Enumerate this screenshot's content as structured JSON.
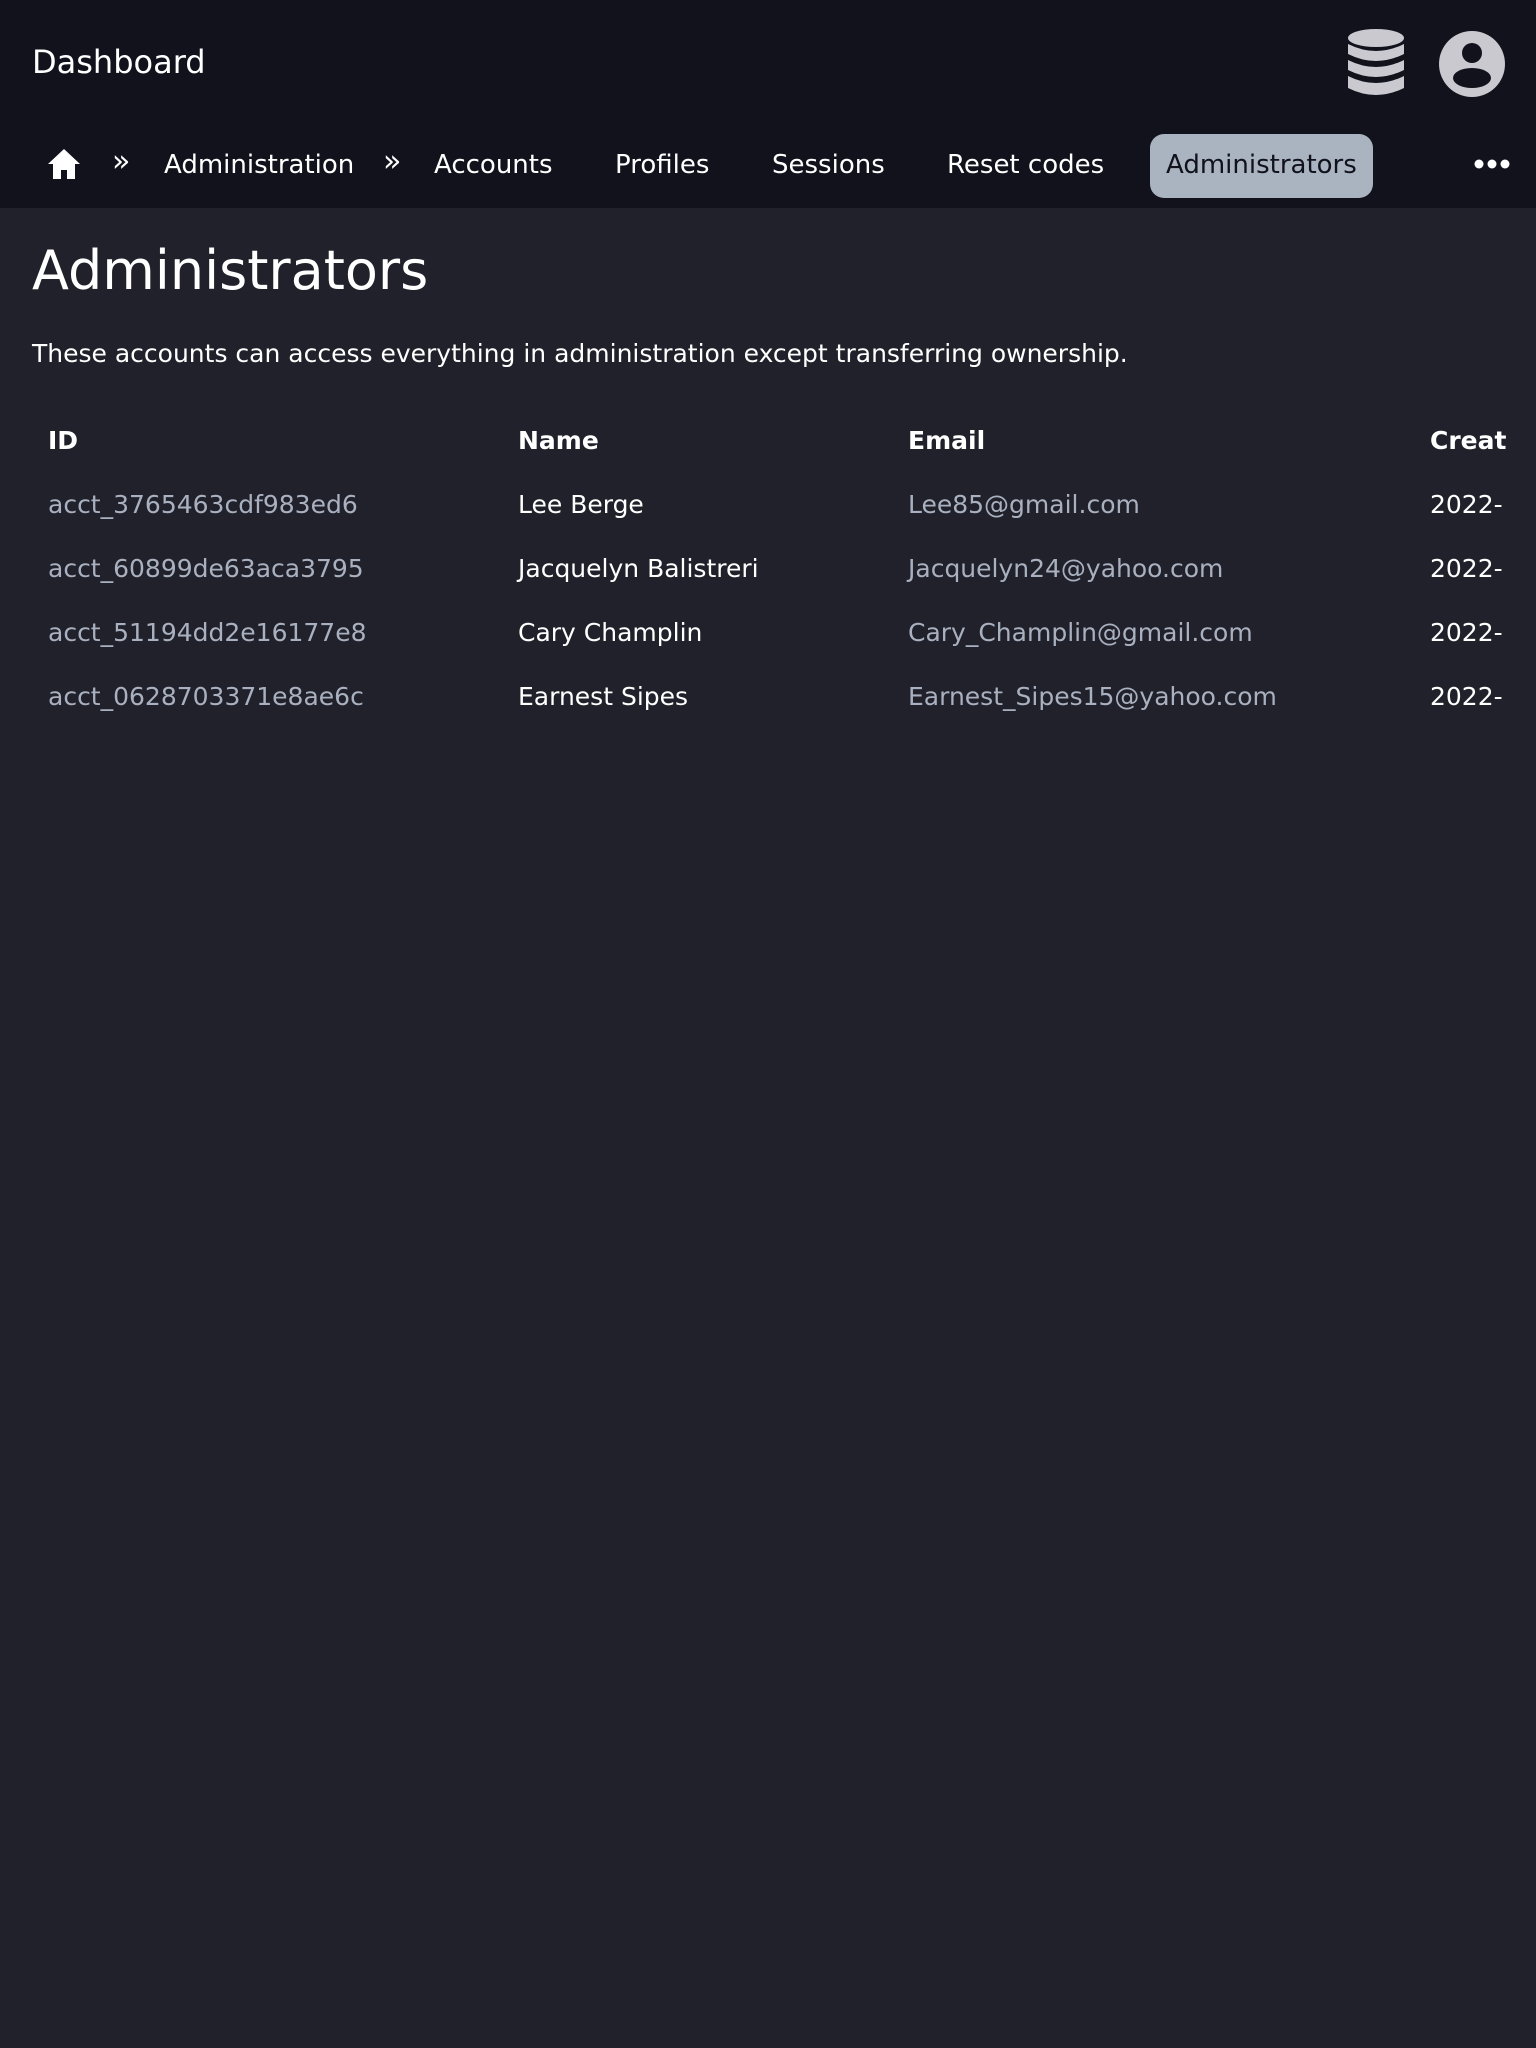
{
  "header": {
    "title": "Dashboard",
    "icons": [
      "database-icon",
      "user-avatar-icon"
    ]
  },
  "breadcrumb": {
    "home_icon": "home-icon",
    "separator": "»",
    "root": "Administration",
    "items": [
      {
        "label": "Accounts",
        "active": false
      },
      {
        "label": "Profiles",
        "active": false
      },
      {
        "label": "Sessions",
        "active": false
      },
      {
        "label": "Reset codes",
        "active": false
      },
      {
        "label": "Administrators",
        "active": true
      }
    ],
    "more_icon": "more-horizontal-icon"
  },
  "main": {
    "title": "Administrators",
    "description": "These accounts can access everything in administration except transferring ownership."
  },
  "table": {
    "columns": [
      "ID",
      "Name",
      "Email",
      "Creat"
    ],
    "rows": [
      {
        "id": "acct_3765463cdf983ed6",
        "name": "Lee Berge",
        "email": "Lee85@gmail.com",
        "created": "2022-"
      },
      {
        "id": "acct_60899de63aca3795",
        "name": "Jacquelyn Balistreri",
        "email": "Jacquelyn24@yahoo.com",
        "created": "2022-"
      },
      {
        "id": "acct_51194dd2e16177e8",
        "name": "Cary Champlin",
        "email": "Cary_Champlin@gmail.com",
        "created": "2022-"
      },
      {
        "id": "acct_0628703371e8ae6c",
        "name": "Earnest Sipes",
        "email": "Earnest_Sipes15@yahoo.com",
        "created": "2022-"
      }
    ]
  },
  "colors": {
    "background": "#21212b",
    "header": "#11121c",
    "active_tab": "#a9b4c0",
    "muted_text": "#a9b0bf"
  }
}
